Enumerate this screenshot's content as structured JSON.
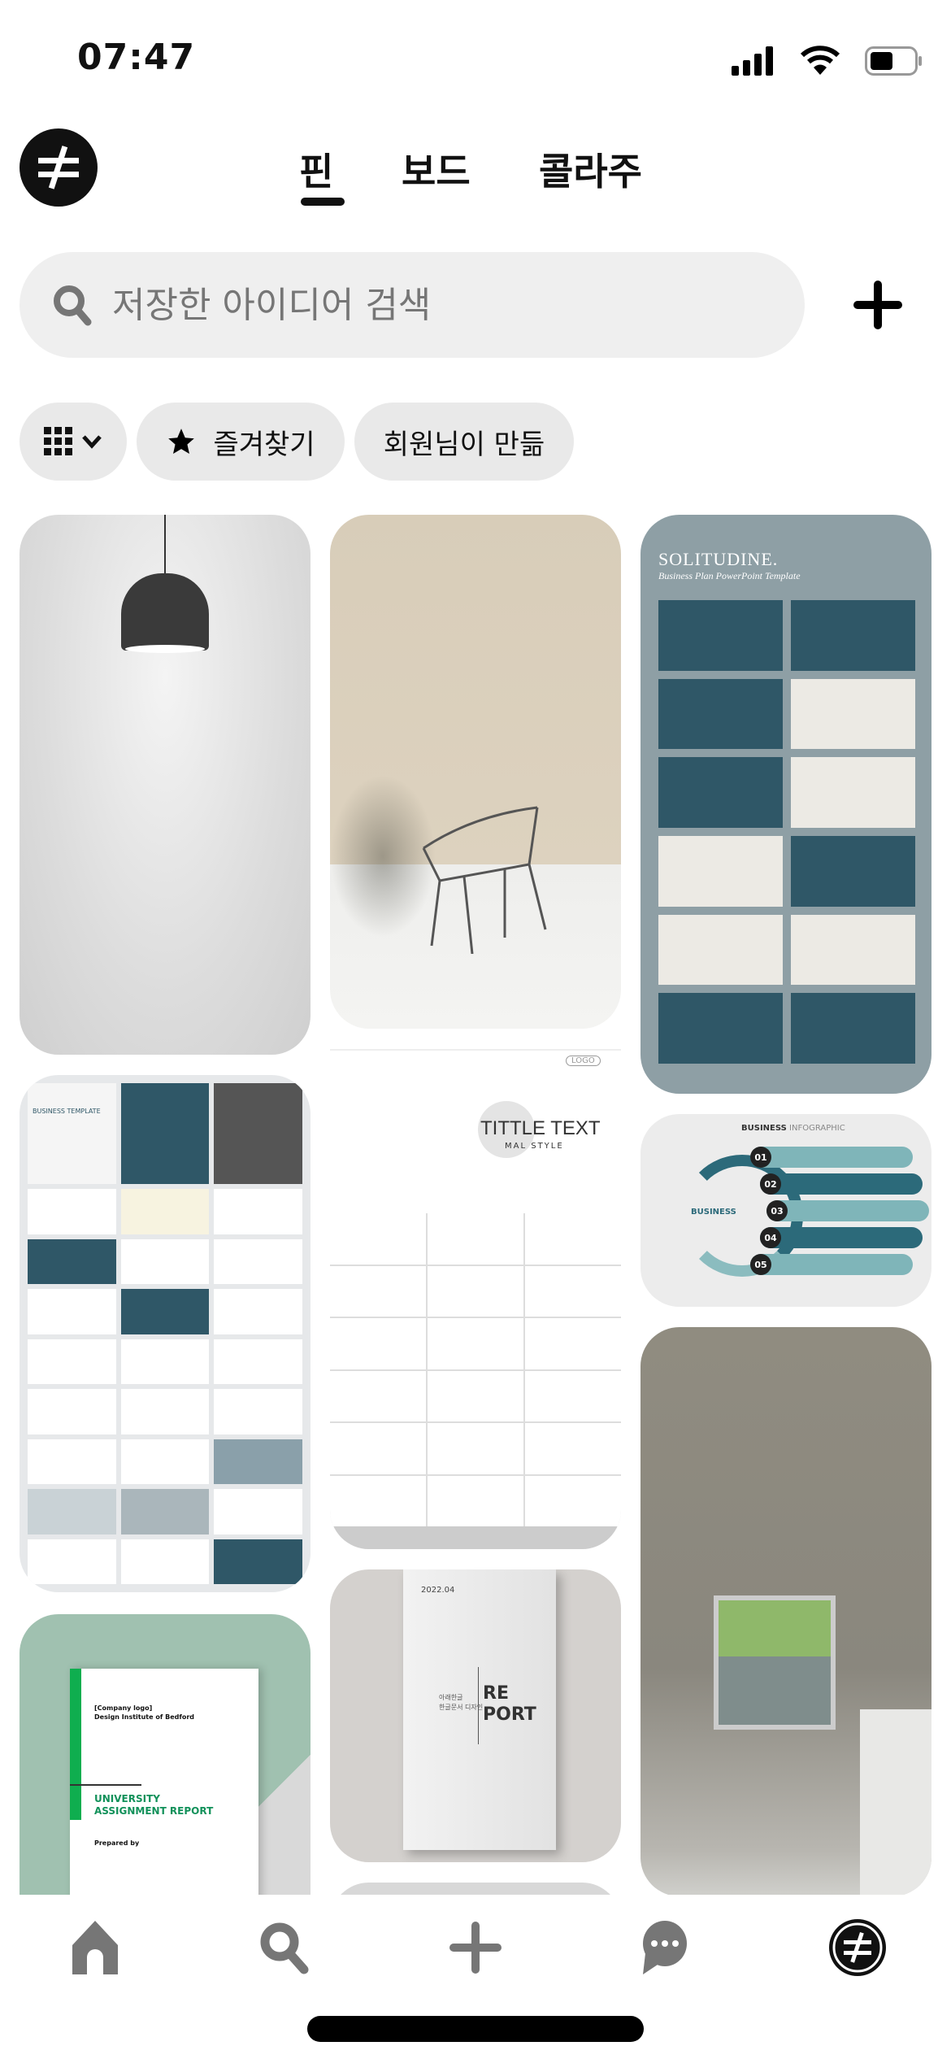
{
  "status_bar": {
    "time": "07:47",
    "icons": [
      "cellular-signal-icon",
      "wifi-icon",
      "battery-icon"
    ]
  },
  "header": {
    "avatar_icon": "not-equal-logo-icon",
    "tabs": [
      {
        "label": "핀",
        "active": true
      },
      {
        "label": "보드",
        "active": false
      },
      {
        "label": "콜라주",
        "active": false
      }
    ]
  },
  "search": {
    "placeholder": "저장한 아이디어 검색",
    "value": "",
    "add_icon": "plus-icon"
  },
  "filters": {
    "layout_icon": "grid-icon",
    "chips": [
      {
        "label": "즐겨찾기",
        "icon": "star-icon"
      },
      {
        "label": "회원님이 만듦"
      }
    ]
  },
  "pins": {
    "lamp": {
      "description": "pendant-lamp-photo"
    },
    "chair": {
      "description": "chair-photo"
    },
    "solitudine": {
      "title": "SOLITUDINE.",
      "subtitle": "Business Plan PowerPoint Template"
    },
    "ppt_grid": {
      "title": "BUSINESS TEMPLATE"
    },
    "tittle": {
      "title": "TITTLE TEXT",
      "subtitle": "MAL STYLE",
      "logo": "LOGO"
    },
    "infographic": {
      "title_bold": "BUSINESS",
      "title_light": "INFOGRAPHIC",
      "center": "BUSINESS",
      "steps": [
        "01",
        "02",
        "03",
        "04",
        "05"
      ]
    },
    "kitchen": {
      "description": "kitchen-window-photo"
    },
    "university": {
      "logo": "[Company logo]",
      "org": "Design Institute of Bedford",
      "title1": "UNIVERSITY",
      "title2": "ASSIGNMENT REPORT",
      "prepared": "Prepared by"
    },
    "report": {
      "date": "2022.04",
      "ko1": "아래한글",
      "ko2": "한글문서 디자인",
      "re": "RE",
      "port": "PORT"
    }
  },
  "bottom_nav": {
    "items": [
      {
        "name": "home",
        "icon": "home-icon"
      },
      {
        "name": "search",
        "icon": "search-icon"
      },
      {
        "name": "create",
        "icon": "plus-icon"
      },
      {
        "name": "messages",
        "icon": "chat-icon"
      },
      {
        "name": "profile",
        "icon": "profile-avatar-icon",
        "active": true
      }
    ]
  },
  "colors": {
    "teal": "#2f5767",
    "chip_bg": "#e9e9e9",
    "search_bg": "#efefef",
    "nav_icon": "#767676",
    "green": "#0fae4f"
  }
}
